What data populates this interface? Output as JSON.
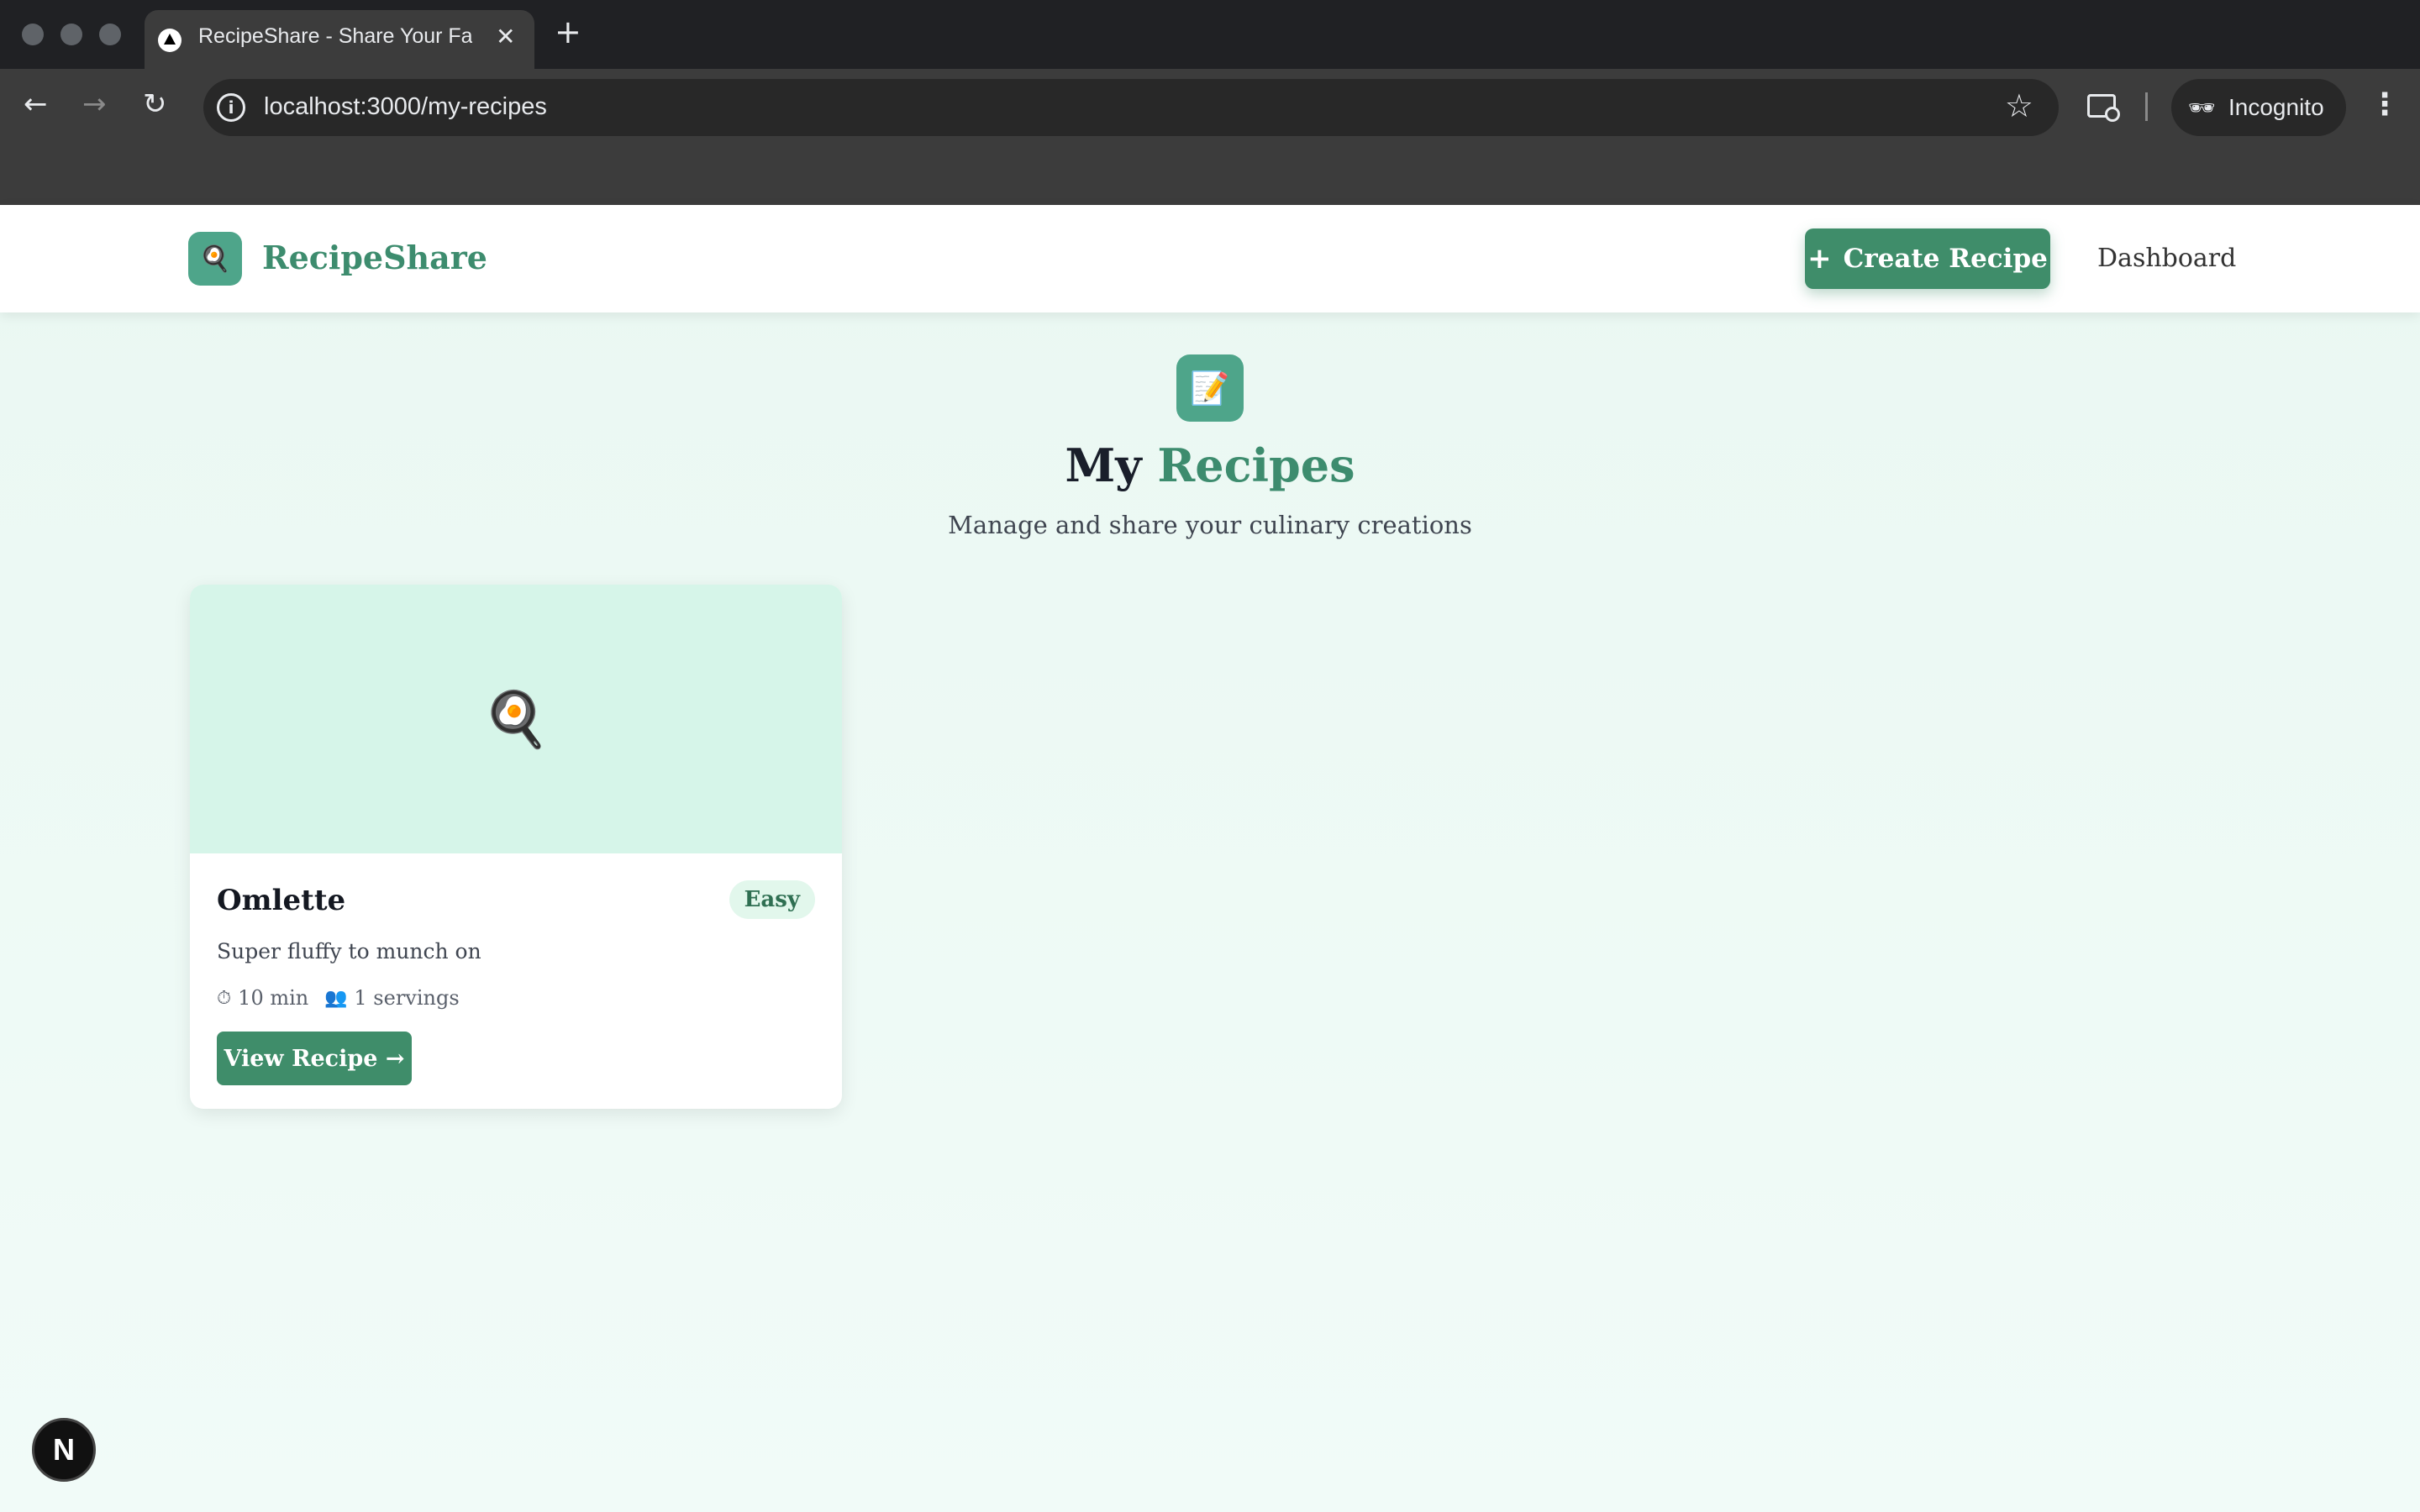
{
  "browser": {
    "tab_title": "RecipeShare - Share Your Favorite Recipes",
    "tab_close": "✕",
    "new_tab": "+",
    "url": "localhost:3000/my-recipes",
    "incognito_label": "Incognito",
    "icons": [
      "back-icon",
      "forward-icon",
      "reload-icon",
      "info-icon",
      "star-icon",
      "tab-search-icon",
      "incognito-icon",
      "menu-icon"
    ]
  },
  "header": {
    "logo_emoji": "🍳",
    "brand": "RecipeShare",
    "create_button": "Create Recipe",
    "create_plus": "+",
    "dashboard_link": "Dashboard"
  },
  "hero": {
    "icon_emoji": "📝",
    "title_prefix": "My",
    "title_accent": "Recipes",
    "subtitle": "Manage and share your culinary creations"
  },
  "recipes": [
    {
      "image_emoji": "🍳",
      "title": "Omlette",
      "difficulty": "Easy",
      "description": "Super fluffy to munch on",
      "time": "10 min",
      "servings": "1 servings",
      "button": "View Recipe →"
    }
  ],
  "devtools": {
    "label": "N"
  },
  "colors": {
    "accent": "#3f8d6a",
    "brand": "#3d8c6e",
    "icon_bg": "#4ea58a",
    "card_image_bg": "#d6f5e9",
    "page_bg": "#eefaf5"
  }
}
